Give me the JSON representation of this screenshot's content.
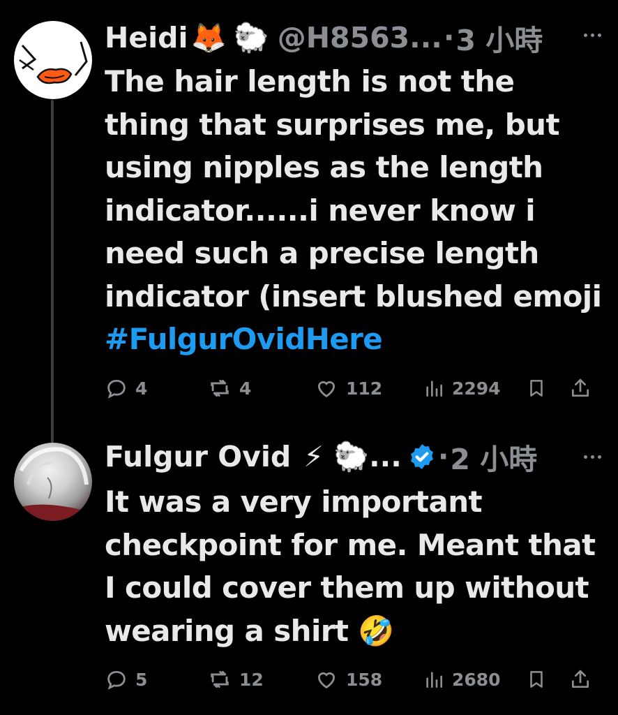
{
  "thread": [
    {
      "author": {
        "name": "Heidi",
        "name_emoji": "🦊",
        "extra_emoji": "🐑",
        "handle": "@H8563...",
        "verified": false
      },
      "separator": "·",
      "time": "3 小時",
      "text": "The hair length is not the thing that surprises me, but using nipples as the length indicator......i never know i need such a precise length indicator (insert blushed emoji",
      "hashtag": "#FulgurOvidHere",
      "stats": {
        "replies": "4",
        "reposts": "4",
        "likes": "112",
        "views": "2294"
      }
    },
    {
      "author": {
        "name": "Fulgur Ovid",
        "name_emoji": "⚡",
        "extra_emoji": "🐑...",
        "handle": "",
        "verified": true
      },
      "separator": "·",
      "time": "2 小時",
      "text": "It was a very important checkpoint for me. Meant that I could cover them up without wearing a shirt 🤣",
      "stats": {
        "replies": "5",
        "reposts": "12",
        "likes": "158",
        "views": "2680"
      }
    }
  ],
  "colors": {
    "background": "#000000",
    "text": "#e7e9ea",
    "muted": "#8b8f94",
    "link": "#1d9bf0",
    "verified": "#1d9bf0"
  }
}
